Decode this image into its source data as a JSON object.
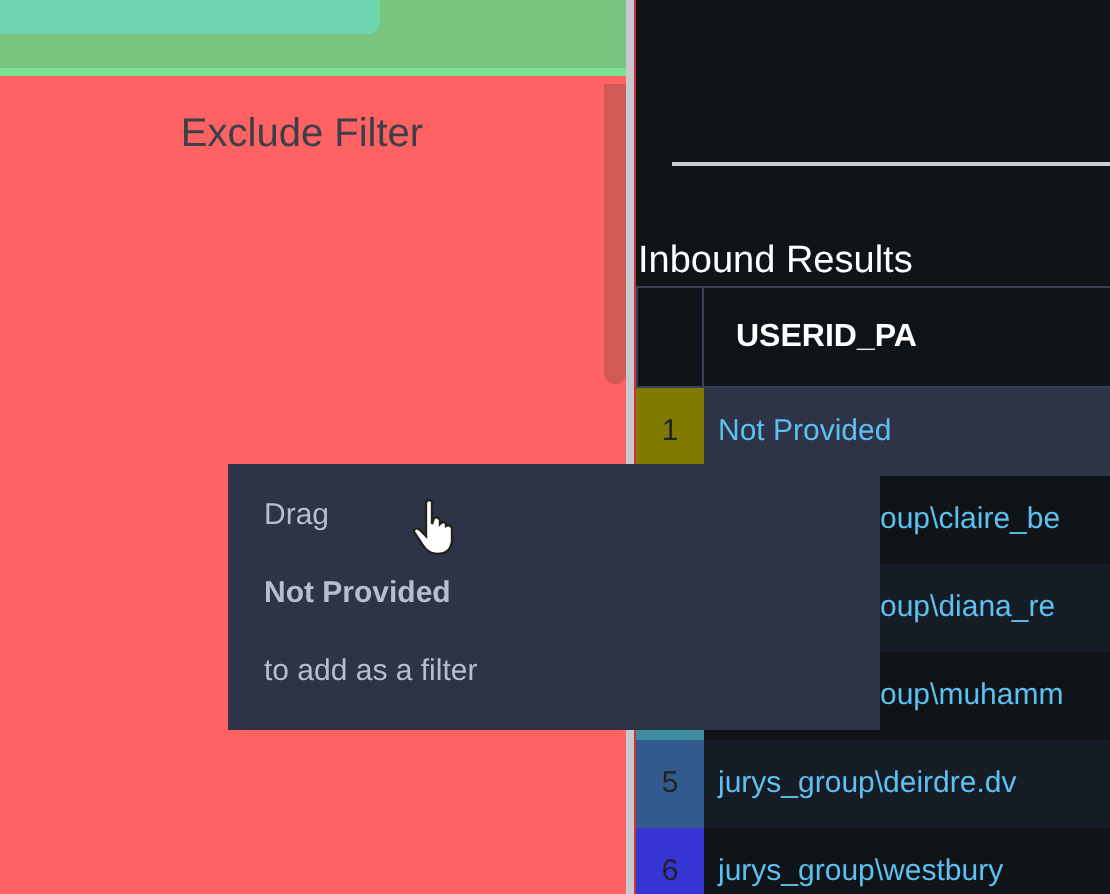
{
  "left_panel": {
    "drop_zone_label": "Exclude Filter"
  },
  "results": {
    "title": "Inbound Results",
    "columns": [
      "USERID_PA"
    ],
    "rows": [
      {
        "index": "1",
        "value": "Not Provided",
        "color": "#807a00",
        "selected": true
      },
      {
        "value": "oup\\claire_be",
        "selected": false
      },
      {
        "value": "oup\\diana_re",
        "selected": false
      },
      {
        "value": "oup\\muhamm",
        "color": "#3f8ea0",
        "selected": false
      },
      {
        "index": "5",
        "value": "jurys_group\\deirdre.dv",
        "color": "#335a8c",
        "selected": false
      },
      {
        "index": "6",
        "value": "jurys_group\\westbury",
        "color": "#3535d5",
        "selected": false
      }
    ]
  },
  "tooltip": {
    "lines": [
      {
        "text": "Drag",
        "kind": "plain"
      },
      {
        "text": "Not Provided",
        "kind": "bold"
      },
      {
        "text": "to add as a filter",
        "kind": "plain"
      }
    ]
  }
}
